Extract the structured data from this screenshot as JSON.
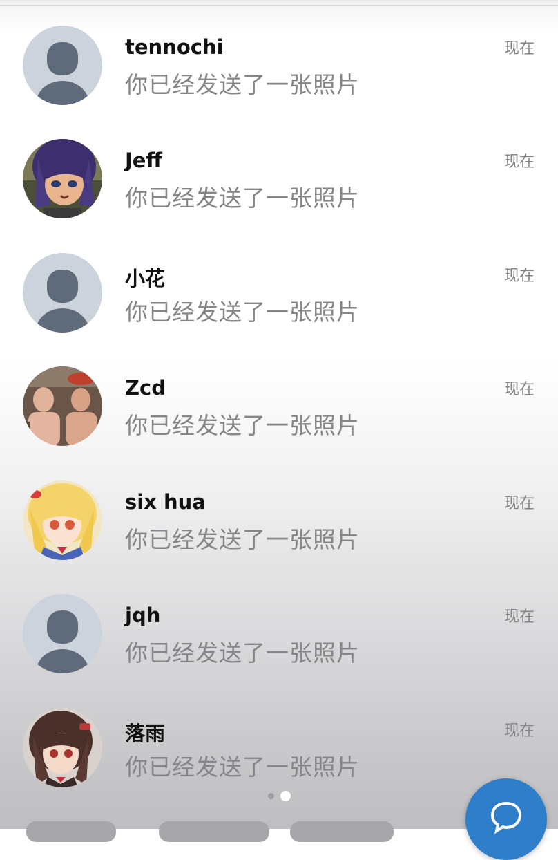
{
  "chat_list": {
    "items": [
      {
        "name": "tennochi",
        "preview": "你已经发送了一张照片",
        "time": "现在",
        "avatar": "default-avatar"
      },
      {
        "name": "Jeff",
        "preview": "你已经发送了一张照片",
        "time": "现在",
        "avatar": "anime-purple-hair-avatar"
      },
      {
        "name": "小花",
        "preview": "你已经发送了一张照片",
        "time": "现在",
        "avatar": "default-avatar"
      },
      {
        "name": "Zcd",
        "preview": "你已经发送了一张照片",
        "time": "现在",
        "avatar": "two-men-photo-avatar"
      },
      {
        "name": "six hua",
        "preview": "你已经发送了一张照片",
        "time": "现在",
        "avatar": "anime-blonde-hair-avatar"
      },
      {
        "name": "jqh",
        "preview": "你已经发送了一张照片",
        "time": "现在",
        "avatar": "default-avatar"
      },
      {
        "name": "落雨",
        "preview": "你已经发送了一张照片",
        "time": "现在",
        "avatar": "anime-brown-hair-avatar"
      }
    ]
  },
  "pager": {
    "page_count": 2,
    "active_page": 2
  },
  "fab": {
    "icon": "new-chat-icon",
    "color": "#2e7ec9"
  },
  "colors": {
    "name_text": "#111111",
    "secondary_text": "#868688",
    "default_avatar_bg": "#ccd3dd",
    "default_avatar_fg": "#5f6b7a"
  }
}
